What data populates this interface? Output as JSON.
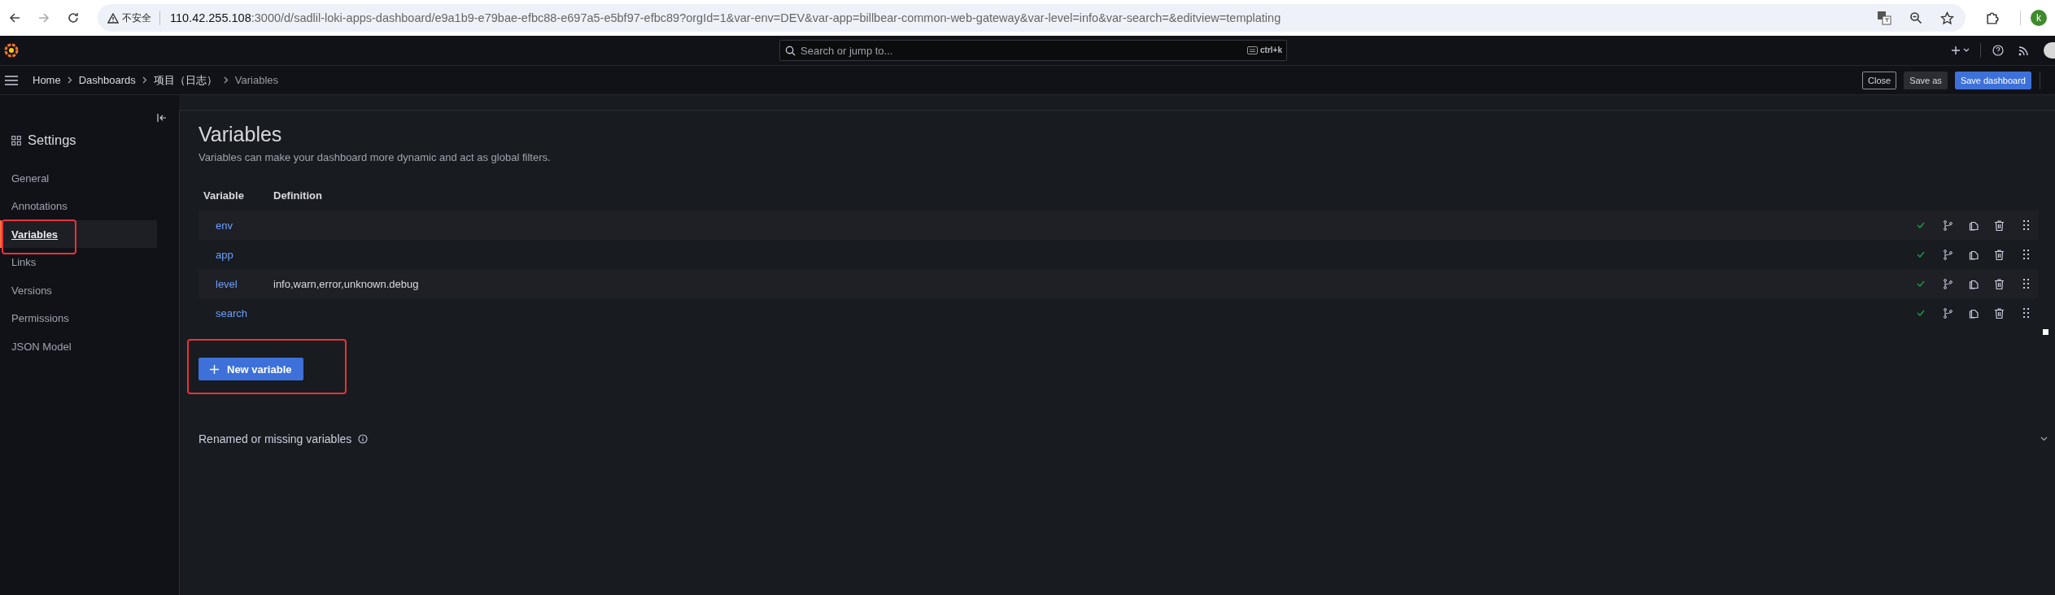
{
  "browser": {
    "security_label": "不安全",
    "url_host": "110.42.255.108",
    "url_rest": ":3000/d/sadlil-loki-apps-dashboard/e9a1b9-e79bae-efbc88-e697a5-e5bf97-efbc89?orgId=1&var-env=DEV&var-app=billbear-common-web-gateway&var-level=info&var-search=&editview=templating",
    "profile_initial": "k"
  },
  "topbar": {
    "search_placeholder": "Search or jump to...",
    "shortcut": "ctrl+k"
  },
  "breadcrumbs": [
    {
      "label": "Home",
      "current": false
    },
    {
      "label": "Dashboards",
      "current": false
    },
    {
      "label": "项目（日志）",
      "current": false
    },
    {
      "label": "Variables",
      "current": true
    }
  ],
  "actions": [
    {
      "label": "Close",
      "kind": "outline"
    },
    {
      "label": "Save as",
      "kind": "secondary"
    },
    {
      "label": "Save dashboard",
      "kind": "primary"
    }
  ],
  "sidebar": {
    "title": "Settings",
    "items": [
      {
        "label": "General",
        "selected": false,
        "highlighted": false
      },
      {
        "label": "Annotations",
        "selected": false,
        "highlighted": false
      },
      {
        "label": "Variables",
        "selected": true,
        "highlighted": true
      },
      {
        "label": "Links",
        "selected": false,
        "highlighted": false
      },
      {
        "label": "Versions",
        "selected": false,
        "highlighted": false
      },
      {
        "label": "Permissions",
        "selected": false,
        "highlighted": false
      },
      {
        "label": "JSON Model",
        "selected": false,
        "highlighted": false
      }
    ]
  },
  "page": {
    "title": "Variables",
    "description": "Variables can make your dashboard more dynamic and act as global filters.",
    "columns": [
      "Variable",
      "Definition"
    ],
    "variables": [
      {
        "name": "env",
        "used": true
      },
      {
        "name": "app",
        "used": true
      },
      {
        "name": "level",
        "definition": "info,warn,error,unknown.debug",
        "used": true
      },
      {
        "name": "search",
        "used": true
      }
    ],
    "new_button": {
      "label": "New variable",
      "highlighted": true
    },
    "renamed_section": {
      "label": "Renamed or missing variables",
      "expanded": false
    }
  }
}
